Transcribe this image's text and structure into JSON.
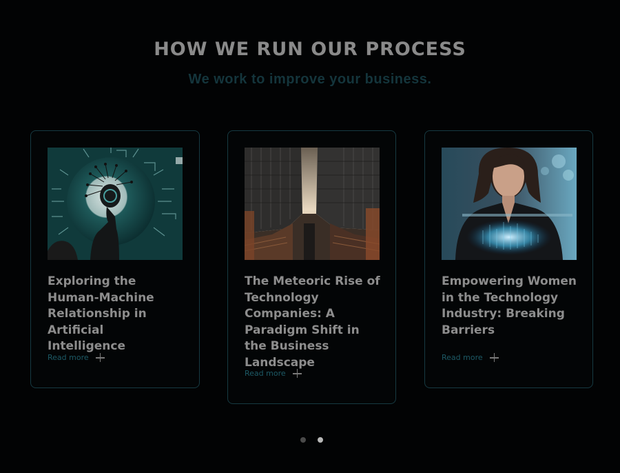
{
  "section": {
    "title": "HOW WE RUN OUR PROCESS",
    "subtitle": "We work to improve your business."
  },
  "cards": [
    {
      "title": "Exploring the Human-Machine Relationship in Artificial Intelligence",
      "read_more": "Read more",
      "image_alt": "robot-head-circuit-image"
    },
    {
      "title": "The Meteoric Rise of Technology Companies: A Paradigm Shift in the Business Landscape",
      "read_more": "Read more",
      "image_alt": "skyscrapers-upward-view-image"
    },
    {
      "title": "Empowering Women in the Technology Industry: Breaking Barriers",
      "read_more": "Read more",
      "image_alt": "woman-holographic-laptop-image"
    }
  ],
  "pagination": {
    "count": 2,
    "active_index": 1
  },
  "colors": {
    "background": "#020304",
    "card_border": "#163a42",
    "accent": "#1d5a66",
    "title_text": "#8d8d8d"
  }
}
